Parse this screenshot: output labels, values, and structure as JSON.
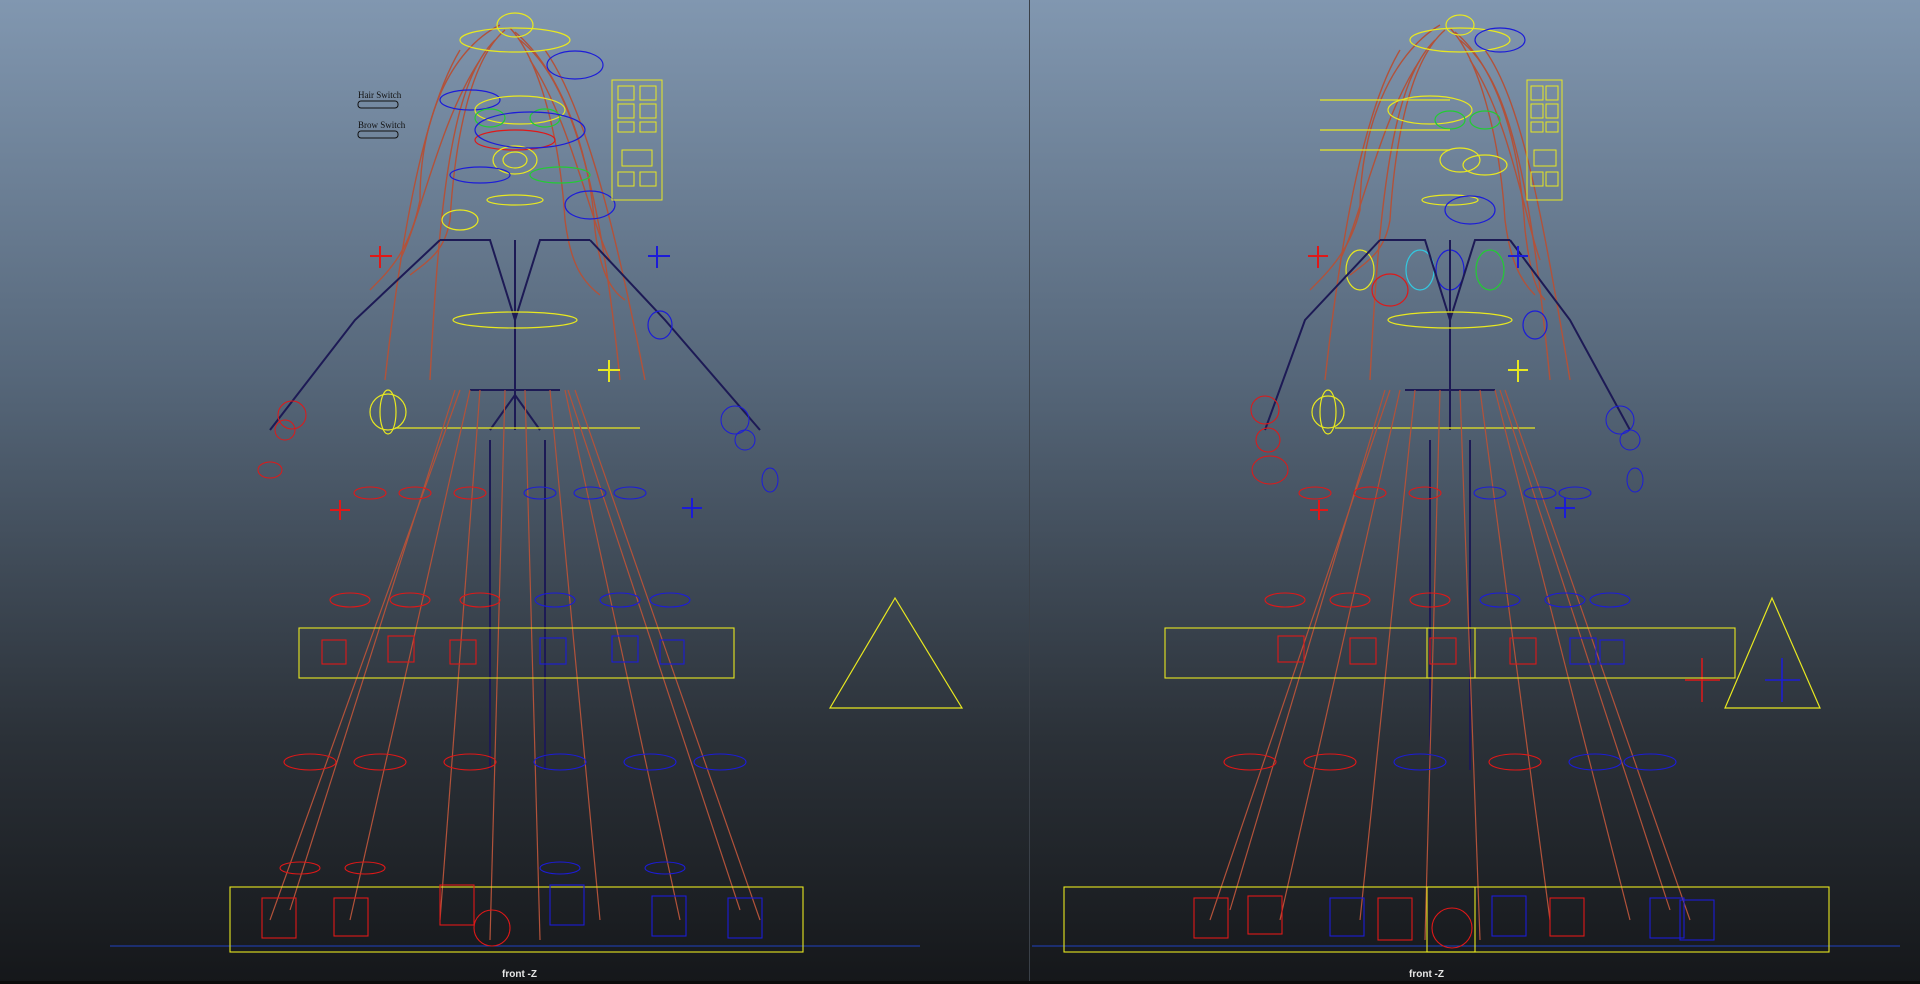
{
  "viewports": [
    {
      "camera_label": "front -Z",
      "switch_labels": [
        "Hair Switch",
        "Brow Switch"
      ]
    },
    {
      "camera_label": "front -Z"
    }
  ],
  "colors": {
    "joint": "#b2523a",
    "bone": "#1d1a55",
    "ctrl_left": "#e01818",
    "ctrl_right": "#1c1cd8",
    "ctrl_center": "#e8e820",
    "ctrl_green": "#22cc33",
    "ctrl_cyan": "#33c8e0",
    "ground_line": "#2040c0"
  }
}
